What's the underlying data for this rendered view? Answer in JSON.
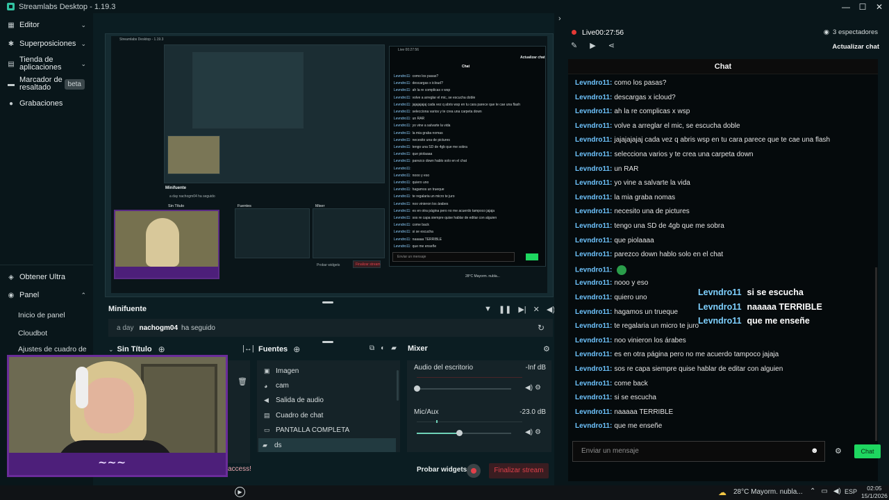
{
  "window": {
    "title": "Streamlabs Desktop - 1.19.3",
    "controls": [
      "—",
      "☐",
      "✕"
    ]
  },
  "sidebar": {
    "items": [
      {
        "label": "Editor",
        "icon": "layout-icon"
      },
      {
        "label": "Superposiciones",
        "icon": "overlay-icon"
      },
      {
        "label": "Tienda de aplicaciones",
        "icon": "store-icon"
      },
      {
        "label": "Marcador de resaltado",
        "icon": "highlight-icon",
        "badge": "beta"
      },
      {
        "label": "Grabaciones",
        "icon": "record-icon"
      }
    ],
    "bottom": {
      "ultra": "Obtener Ultra",
      "panel": "Panel",
      "sub": [
        "Inicio de panel",
        "Cloudbot",
        "Ajustes de cuadro de"
      ]
    }
  },
  "preview": {
    "nested_title": "Streamlabs Desktop - 1.19.3",
    "nested_live": "Live 00:27:56",
    "nested_chat": "Chat",
    "nested_refresh": "Actualizar chat",
    "nested_minifuente": "Minifuente",
    "nested_event": "a day  nachogm04  ha seguido",
    "nested_scene": "Sin Título",
    "nested_sources": "Fuentes",
    "nested_mixer": "Mixer",
    "nested_test": "Probar widgets",
    "nested_end": "Finalizar stream",
    "nested_input": "Enviar un mensaje",
    "nested_weather": "28°C  Mayorm. nubla..."
  },
  "minifuente": {
    "title": "Minifuente",
    "event": {
      "time": "a day",
      "user": "nachogm04",
      "action": "ha seguido"
    }
  },
  "scenes": {
    "title": "Sin Título",
    "partial_text": "access!"
  },
  "sources": {
    "title": "Fuentes",
    "items": [
      {
        "label": "Imagen",
        "icon": "image-icon"
      },
      {
        "label": "cam",
        "icon": "camera-icon"
      },
      {
        "label": "Salida de audio",
        "icon": "speaker-icon"
      },
      {
        "label": "Cuadro de chat",
        "icon": "chat-icon"
      },
      {
        "label": "PANTALLA COMPLETA",
        "icon": "monitor-icon"
      },
      {
        "label": "ds",
        "icon": "folder-icon"
      }
    ]
  },
  "mixer": {
    "title": "Mixer",
    "channels": [
      {
        "name": "Audio del escritorio",
        "level": "-Inf dB",
        "volume": 0.0
      },
      {
        "name": "Mic/Aux",
        "level": "-23.0 dB",
        "volume": 0.45
      }
    ]
  },
  "footer": {
    "test_widgets": "Probar widgets",
    "end_stream": "Finalizar stream"
  },
  "stream": {
    "live_label": "Live",
    "time": "00:27:56",
    "viewers": "3 espectadores",
    "refresh_chat": "Actualizar chat"
  },
  "chat": {
    "title": "Chat",
    "messages": [
      {
        "user": "Levndro11:",
        "text": "como los pasas?"
      },
      {
        "user": "Levndro11:",
        "text": "descargas x icloud?"
      },
      {
        "user": "Levndro11:",
        "text": "ah la re complicas x wsp"
      },
      {
        "user": "Levndro11:",
        "text": "volve a arreglar el mic, se escucha doble"
      },
      {
        "user": "Levndro11:",
        "text": "jajajajajaj cada vez q abris wsp en tu cara parece que te cae una flash"
      },
      {
        "user": "Levndro11:",
        "text": "selecciona varios y te crea una carpeta down"
      },
      {
        "user": "Levndro11:",
        "text": "un RAR"
      },
      {
        "user": "Levndro11:",
        "text": "yo vine a salvarte la vida"
      },
      {
        "user": "Levndro11:",
        "text": "la mia graba nomas"
      },
      {
        "user": "Levndro11:",
        "text": "necesito una de pictures"
      },
      {
        "user": "Levndro11:",
        "text": "tengo una SD de 4gb que me sobra"
      },
      {
        "user": "Levndro11:",
        "text": "que piolaaaa"
      },
      {
        "user": "Levndro11:",
        "text": "parezco down hablo solo en el chat"
      },
      {
        "user": "Levndro11:",
        "text": ""
      },
      {
        "user": "Levndro11:",
        "text": "nooo y eso"
      },
      {
        "user": "Levndro11:",
        "text": "quiero uno"
      },
      {
        "user": "Levndro11:",
        "text": "hagamos un trueque"
      },
      {
        "user": "Levndro11:",
        "text": "te regalaria un micro te juro"
      },
      {
        "user": "Levndro11:",
        "text": "noo vinieron los árabes"
      },
      {
        "user": "Levndro11:",
        "text": "es en otra página pero no me acuerdo tampoco jajaja"
      },
      {
        "user": "Levndro11:",
        "text": "sos re capa siempre quise hablar de editar con alguien"
      },
      {
        "user": "Levndro11:",
        "text": "come back"
      },
      {
        "user": "Levndro11:",
        "text": "si se escucha"
      },
      {
        "user": "Levndro11:",
        "text": "naaaaa TERRIBLE"
      },
      {
        "user": "Levndro11:",
        "text": "que me enseñe"
      }
    ],
    "overlay": [
      {
        "user": "Levndro11",
        "text": "si se escucha"
      },
      {
        "user": "Levndro11",
        "text": "naaaaa TERRIBLE"
      },
      {
        "user": "Levndro11",
        "text": "que me enseñe"
      }
    ],
    "input_placeholder": "Enviar un mensaje",
    "send_label": "Chat"
  },
  "taskbar": {
    "weather": "28°C  Mayorm. nubla...",
    "lang": "ESP",
    "time": "02:05",
    "date": "15/1/2026"
  },
  "colors": {
    "accent": "#31c3a2",
    "live_red": "#e53935",
    "chat_user": "#6ec4ff",
    "send_green": "#1ed760",
    "end_stream": "#e0404a"
  }
}
